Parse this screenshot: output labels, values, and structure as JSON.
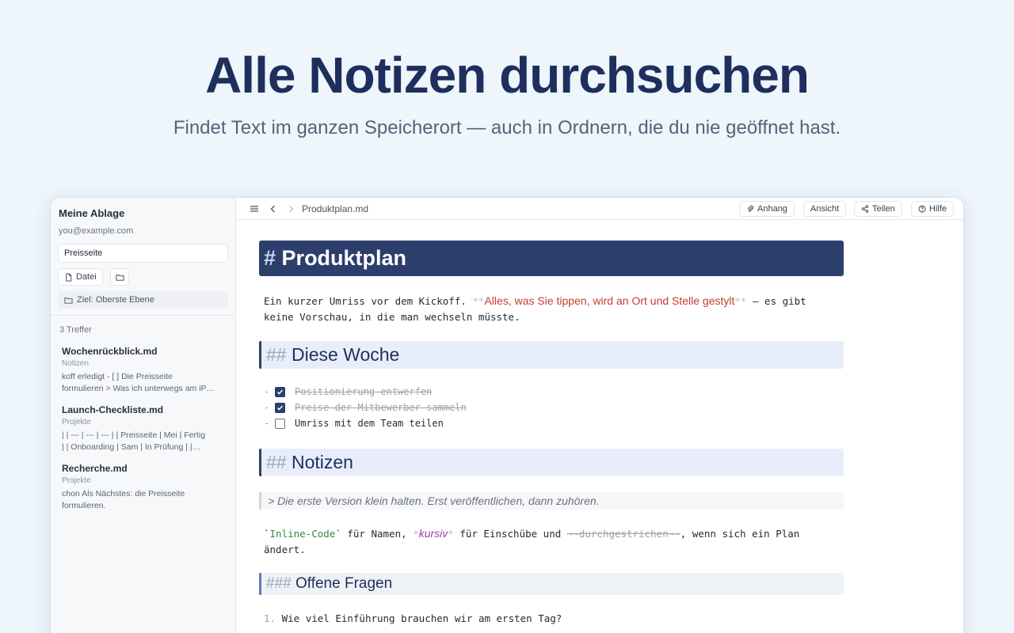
{
  "hero": {
    "title": "Alle Notizen durchsuchen",
    "subtitle": "Findet Text im ganzen Speicherort — auch in Ordnern, die du nie geöffnet hast."
  },
  "sidebar": {
    "title": "Meine Ablage",
    "email": "you@example.com",
    "search_value": "Preisseite",
    "file_button_label": "Datei",
    "target_label": "Ziel: Oberste Ebene",
    "result_count": "3 Treffer",
    "results": [
      {
        "name": "Wochenrückblick.md",
        "folder": "Notizen",
        "snippet": "koff erledigt - [ ] Die Preisseite\nformulieren > Was ich unterwegs am iP…"
      },
      {
        "name": "Launch-Checkliste.md",
        "folder": "Projekte",
        "snippet": "| | --- | --- | --- | | Preisseite | Mei | Fertig\n| | Onboarding | Sam | In Prüfung | |…"
      },
      {
        "name": "Recherche.md",
        "folder": "Projekte",
        "snippet": "chon Als Nächstes: die Preisseite\nformulieren."
      }
    ]
  },
  "topbar": {
    "file_name": "Produktplan.md",
    "buttons": {
      "attachment": "Anhang",
      "view": "Ansicht",
      "share": "Teilen",
      "help": "Hilfe"
    }
  },
  "doc": {
    "h1_hash": "#",
    "h1": "Produktplan",
    "intro_a": "Ein kurzer Umriss vor dem Kickoff. ",
    "intro_marker": "**",
    "intro_bold": "Alles, was Sie tippen, wird an Ort und Stelle gestylt",
    "intro_b": " — es gibt",
    "intro_line2": "keine Vorschau, in die man wechseln müsste.",
    "h2_hash": "##",
    "h2_week": "Diese Woche",
    "tasks": [
      {
        "dash": "-",
        "text": "Positionierung entwerfen",
        "done": true
      },
      {
        "dash": "-",
        "text": "Preise der Mitbewerber sammeln",
        "done": true
      },
      {
        "dash": "-",
        "text": "Umriss mit dem Team teilen",
        "done": false
      }
    ],
    "h2_notes": "Notizen",
    "quote": "> Die erste Version klein halten. Erst veröffentlichen, dann zuhören.",
    "code_tick": "`",
    "code_text": "Inline-Code",
    "t1": " für Namen, ",
    "ital_marker": "*",
    "ital_text": "kursiv",
    "t2": " für Einschübe und ",
    "strike_text": "~~durchgestrichen~~",
    "t3": ", wenn sich ein Plan",
    "t4": "ändert.",
    "h3_hash": "###",
    "h3": "Offene Fragen",
    "questions": [
      {
        "num": "1.",
        "text": "Wie viel Einführung brauchen wir am ersten Tag?"
      }
    ]
  }
}
